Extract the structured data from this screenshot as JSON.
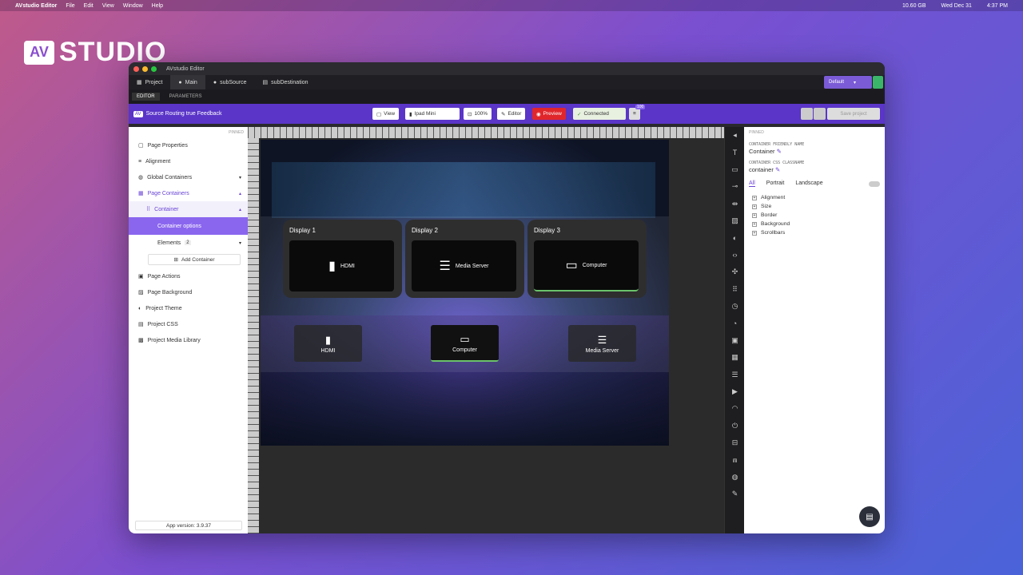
{
  "menubar": {
    "app": "AVstudio Editor",
    "items": [
      "File",
      "Edit",
      "View",
      "Window",
      "Help"
    ],
    "storage": "10.60 GB",
    "date": "Wed Dec 31",
    "time": "4:37 PM"
  },
  "logo": {
    "mark": "AV",
    "word": "STUDIO"
  },
  "window": {
    "title": "AVstudio Editor"
  },
  "tabs": [
    {
      "label": "Project"
    },
    {
      "label": "Main"
    },
    {
      "label": "subSource"
    },
    {
      "label": "subDestination"
    }
  ],
  "profile": {
    "label": "Default"
  },
  "subtabs": {
    "editor": "EDITOR",
    "parameters": "PARAMETERS"
  },
  "toolbar": {
    "project_title": "Source Routing true Feedback",
    "view": "View",
    "device": "Ipad Mini",
    "zoom": "100%",
    "editor": "Editor",
    "preview": "Preview",
    "connected": "Connected",
    "badge": "100",
    "save": "Save project"
  },
  "sidebar": {
    "pinned": "PINNED",
    "items": [
      "Page Properties",
      "Alignment",
      "Global Containers",
      "Page Containers",
      "Container",
      "Container options",
      "Elements"
    ],
    "elements_count": "2",
    "add_container": "Add Container",
    "items2": [
      "Page Actions",
      "Page Background",
      "Project Theme",
      "Project CSS",
      "Project Media Library"
    ],
    "version": "App version: 3.9.37"
  },
  "displays": [
    {
      "title": "Display 1",
      "source": "HDMI"
    },
    {
      "title": "Display 2",
      "source": "Media Server"
    },
    {
      "title": "Display 3",
      "source": "Computer"
    }
  ],
  "sources": [
    {
      "label": "HDMI"
    },
    {
      "label": "Computer"
    },
    {
      "label": "Media Server"
    }
  ],
  "rpanel": {
    "pinned": "PINNED",
    "name_label": "CONTAINER FRIENDLY NAME",
    "name_value": "Container",
    "css_label": "CONTAINER CSS CLASSNAME",
    "css_value": "container",
    "tabs": [
      "All",
      "Portrait",
      "Landscape"
    ],
    "sections": [
      "Alignment",
      "Size",
      "Border",
      "Background",
      "Scrollbars"
    ]
  }
}
